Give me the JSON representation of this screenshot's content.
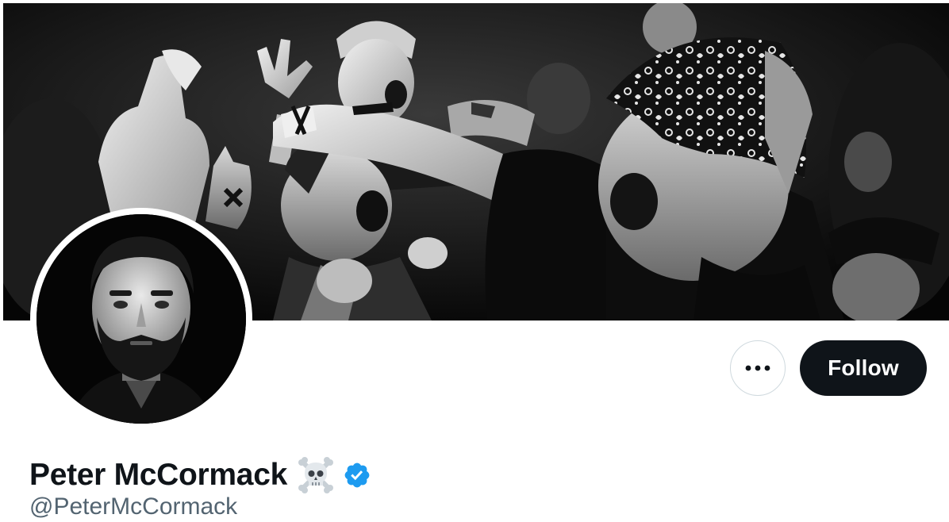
{
  "profile": {
    "display_name": "Peter McCormack",
    "handle": "@PeterMcCormack",
    "name_emoji": "skull-and-crossbones",
    "verified": true
  },
  "actions": {
    "more_label": "•••",
    "follow_label": "Follow"
  },
  "banner": {
    "description_icon": "banner-image",
    "style": "black-and-white concert crowd photo"
  },
  "colors": {
    "follow_bg": "#0f1419",
    "follow_text": "#ffffff",
    "handle_text": "#536471",
    "name_text": "#0f1419",
    "verified_blue": "#1d9bf0",
    "border": "#cfd9de"
  }
}
